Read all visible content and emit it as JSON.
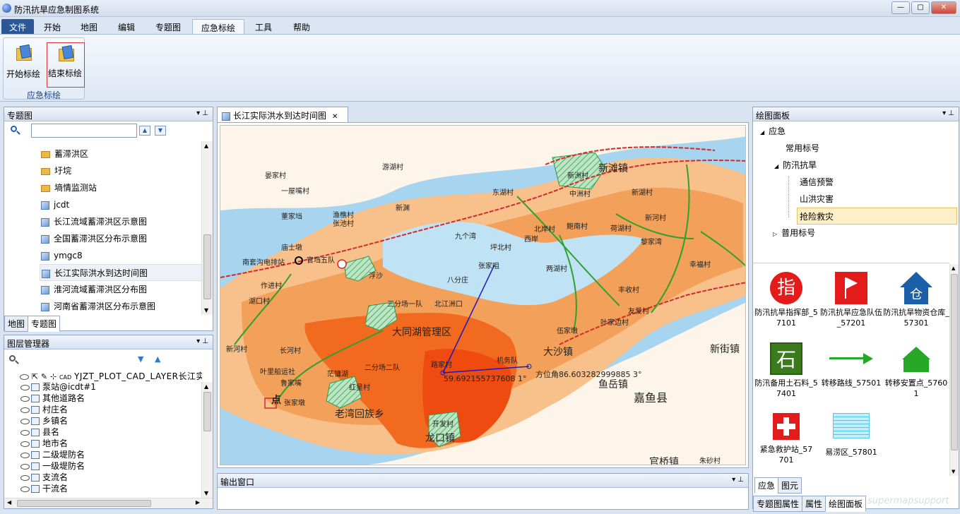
{
  "app": {
    "title": "防汛抗旱应急制图系统",
    "min": "—",
    "max": "▢",
    "close": "✕"
  },
  "menu": {
    "items": [
      "文件",
      "开始",
      "地图",
      "编辑",
      "专题图",
      "应急标绘",
      "工具",
      "帮助"
    ]
  },
  "ribbon": {
    "start_label": "开始标绘",
    "end_label": "结束标绘",
    "group_label": "应急标绘"
  },
  "thematic_panel": {
    "title": "专题图",
    "pin": "▾ ⌖",
    "items": [
      "蓄滞洪区",
      "圩垸",
      "墒情监测站",
      "jcdt",
      "长江流域蓄滞洪区示意图",
      "全国蓄滞洪区分布示意图",
      "ymgc8",
      "长江实际洪水到达时间图",
      "淮河流域蓄滞洪区分布图",
      "河南省蓄滞洪区分布示意图"
    ],
    "tabs": [
      "地图",
      "专题图"
    ]
  },
  "layer_panel": {
    "title": "图层管理器",
    "top_layer": "YJZT_PLOT_CAD_LAYER长江实",
    "items": [
      "泵站@icdt#1",
      "其他道路名",
      "村庄名",
      "乡镇名",
      "县名",
      "地市名",
      "二级堤防名",
      "一级堤防名",
      "支流名",
      "干流名"
    ]
  },
  "doc": {
    "tab_title": "长江实际洪水到达时间图",
    "close": "✕"
  },
  "output": {
    "title": "输出窗口"
  },
  "draw_panel": {
    "title": "绘图面板",
    "tree": [
      "应急",
      "常用标号",
      "防汛抗旱",
      "通信预警",
      "山洪灾害",
      "抢险救灾",
      "普用标号"
    ],
    "symbols": [
      {
        "label": "防汛抗旱指挥部_57101",
        "icon": "指"
      },
      {
        "label": "防汛抗旱应急队伍_57201",
        "icon": "flag"
      },
      {
        "label": "防汛抗旱物资仓库_57301",
        "icon": "仓"
      },
      {
        "label": "防汛备用土石料_57401",
        "icon": "石"
      },
      {
        "label": "转移路线_57501",
        "icon": "arrow"
      },
      {
        "label": "转移安置点_57601",
        "icon": "house"
      },
      {
        "label": "紧急救护站_57701",
        "icon": "cross"
      },
      {
        "label": "易涝区_57801",
        "icon": "water"
      }
    ],
    "bottom_tabs": [
      "应急",
      "图元"
    ],
    "outer_tabs": [
      "专题图属性",
      "属性",
      "绘图面板"
    ]
  },
  "map": {
    "labels": [
      "晏家村",
      "游湖村",
      "一屋嘴村",
      "新滩镇",
      "新洲村",
      "中洲村",
      "东湖村",
      "新湖村",
      "董家垱",
      "渔樵村",
      "张池村",
      "新渊",
      "九个湾",
      "坪北村",
      "北岸村",
      "鲍南村",
      "荷湖村",
      "新河村",
      "西岸",
      "黎家湾",
      "庙士墩",
      "官垱五队",
      "南套沟电排站",
      "张家咀",
      "幸福村",
      "两湖村",
      "作进村",
      "浮沙",
      "八分庄",
      "丰收村",
      "三分场一队",
      "北江洲口",
      "友爱村",
      "湖口村",
      "叶家边村",
      "伍家墩",
      "大同湖管理区",
      "大沙镇",
      "新河村",
      "长河村",
      "新街镇",
      "机务队",
      "路家村",
      "叶里船运社",
      "二分场二队",
      "茫镛湖",
      "鱼岳镇",
      "鲁家嘴",
      "红星村",
      "张家墩",
      "嘉鱼县",
      "老湾回族乡",
      "开发村",
      "龙口镇",
      "官桥镇",
      "朱砂村",
      "点"
    ],
    "measure1": "59.692155737608 1°",
    "measure2": "方位角86.603282999885 3°"
  },
  "watermark": "supermapsupport"
}
